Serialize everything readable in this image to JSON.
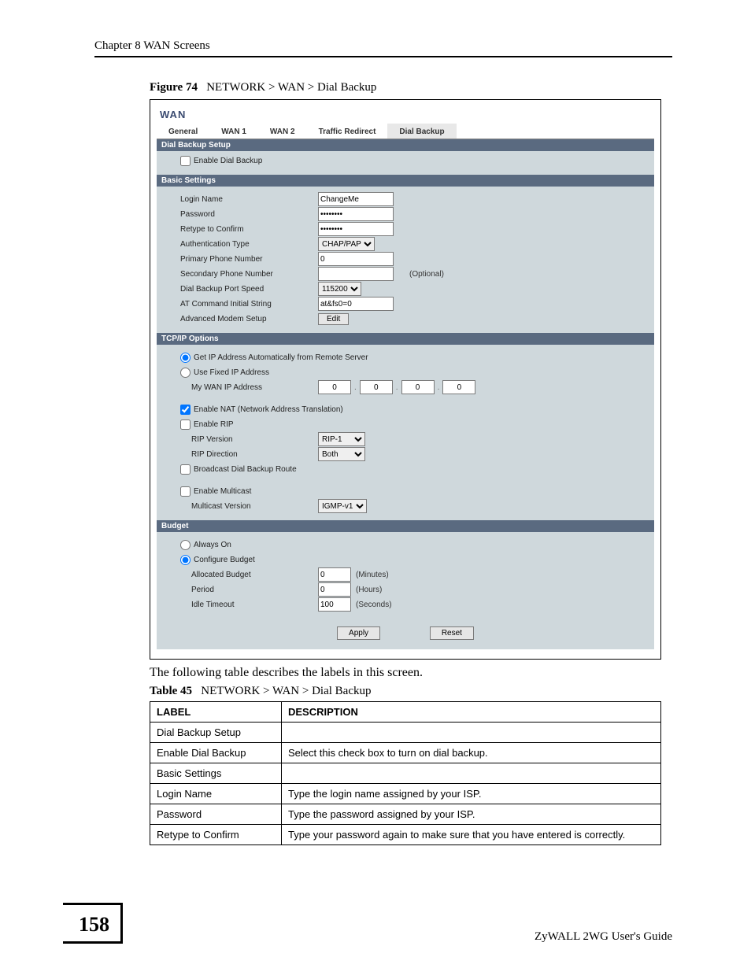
{
  "chapter": "Chapter 8 WAN Screens",
  "figure": {
    "num": "Figure 74",
    "path": "NETWORK > WAN > Dial Backup"
  },
  "screenshot": {
    "title": "WAN",
    "tabs": [
      "General",
      "WAN 1",
      "WAN 2",
      "Traffic Redirect",
      "Dial Backup"
    ],
    "activeTab": 4,
    "s1_head": "Dial Backup Setup",
    "s1_enable": "Enable Dial Backup",
    "s2_head": "Basic Settings",
    "s2": {
      "login_lbl": "Login Name",
      "login_val": "ChangeMe",
      "pwd_lbl": "Password",
      "pwd_val": "********",
      "retype_lbl": "Retype to Confirm",
      "retype_val": "********",
      "auth_lbl": "Authentication Type",
      "auth_val": "CHAP/PAP",
      "pphone_lbl": "Primary Phone Number",
      "pphone_val": "0",
      "sphone_lbl": "Secondary Phone Number",
      "sphone_val": "",
      "optional": "(Optional)",
      "speed_lbl": "Dial Backup Port Speed",
      "speed_val": "115200",
      "at_lbl": "AT Command Initial String",
      "at_val": "at&fs0=0",
      "adv_lbl": "Advanced Modem Setup",
      "edit_btn": "Edit"
    },
    "s3_head": "TCP/IP Options",
    "s3": {
      "auto": "Get IP Address Automatically from Remote Server",
      "fixed": "Use Fixed IP Address",
      "mywan_lbl": "My WAN IP Address",
      "ip": [
        "0",
        "0",
        "0",
        "0"
      ],
      "nat": "Enable NAT (Network Address Translation)",
      "rip": "Enable RIP",
      "ripv_lbl": "RIP Version",
      "ripv_val": "RIP-1",
      "ripd_lbl": "RIP Direction",
      "ripd_val": "Both",
      "bcast": "Broadcast Dial Backup Route",
      "mcast": "Enable Multicast",
      "mcastv_lbl": "Multicast Version",
      "mcastv_val": "IGMP-v1"
    },
    "s4_head": "Budget",
    "s4": {
      "always": "Always On",
      "conf": "Configure Budget",
      "alloc_lbl": "Allocated Budget",
      "alloc_val": "0",
      "alloc_unit": "(Minutes)",
      "period_lbl": "Period",
      "period_val": "0",
      "period_unit": "(Hours)",
      "idle_lbl": "Idle Timeout",
      "idle_val": "100",
      "idle_unit": "(Seconds)"
    },
    "apply": "Apply",
    "reset": "Reset"
  },
  "post_text": "The following table describes the labels in this screen.",
  "table": {
    "num": "Table 45",
    "path": "NETWORK > WAN > Dial Backup",
    "head": [
      "LABEL",
      "DESCRIPTION"
    ],
    "rows": [
      [
        "Dial Backup Setup",
        ""
      ],
      [
        "Enable Dial Backup",
        "Select this check box to turn on dial backup."
      ],
      [
        "Basic Settings",
        ""
      ],
      [
        "Login Name",
        "Type the login name assigned by your ISP."
      ],
      [
        "Password",
        "Type the password assigned by your ISP."
      ],
      [
        "Retype to Confirm",
        "Type your password again to make sure that you have entered is correctly."
      ]
    ]
  },
  "pagenum": "158",
  "guide": "ZyWALL 2WG User's Guide"
}
